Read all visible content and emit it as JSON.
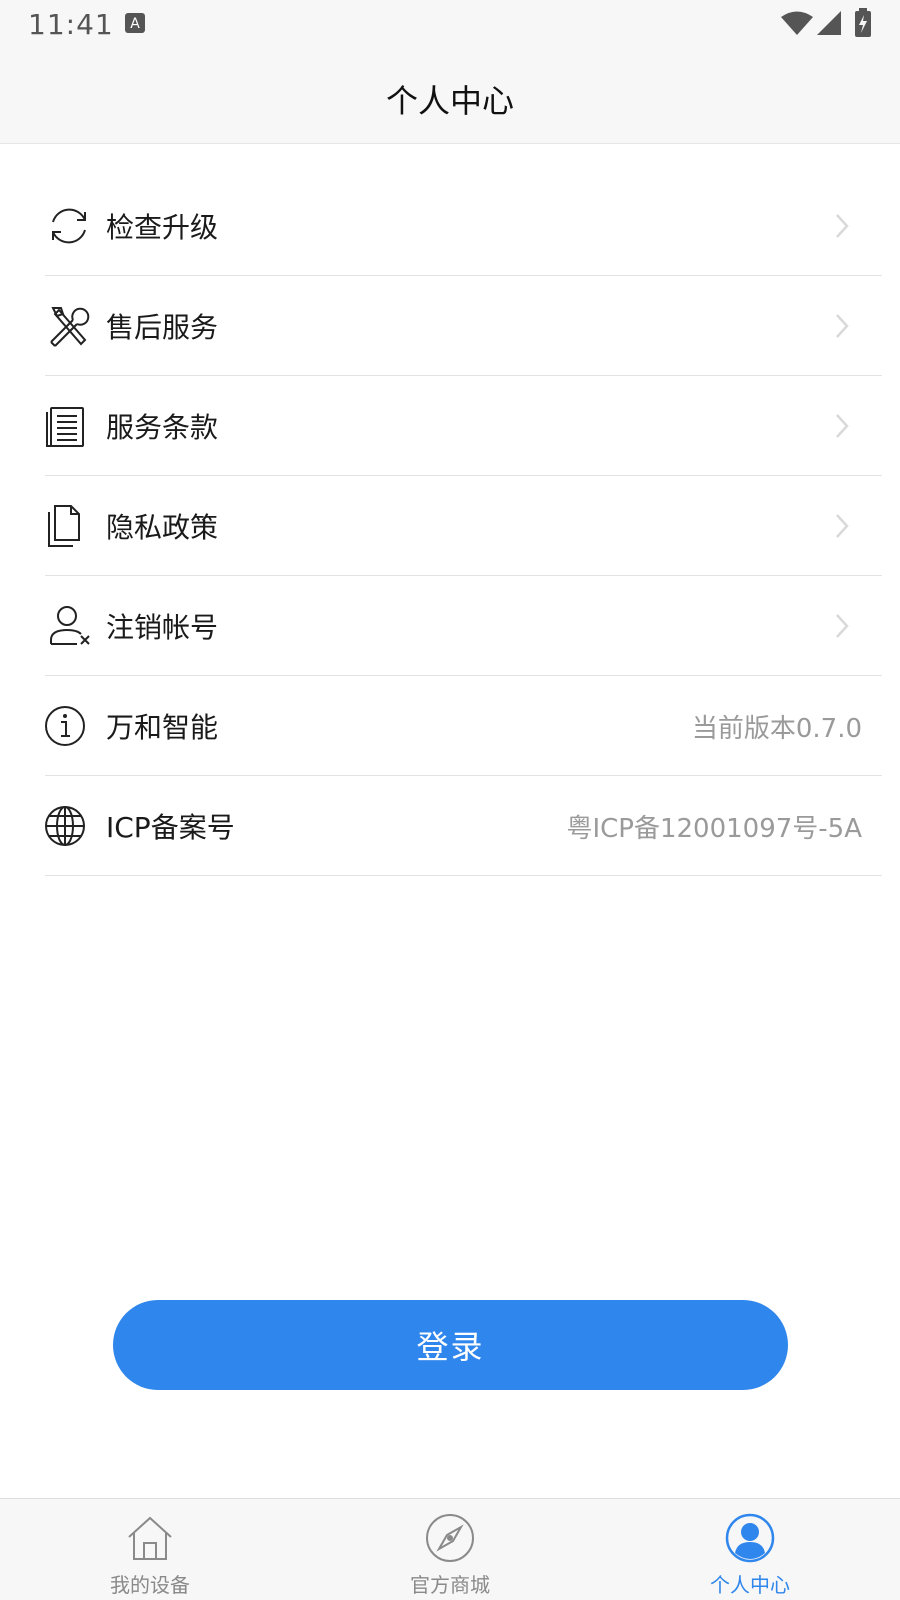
{
  "status_bar": {
    "time": "11:41",
    "icons": [
      "a-notification-icon",
      "wifi-icon",
      "signal-icon",
      "battery-charging-icon"
    ]
  },
  "header": {
    "title": "个人中心"
  },
  "menu": {
    "items": [
      {
        "label": "检查升级",
        "icon": "refresh-icon",
        "value": "",
        "chevron": true
      },
      {
        "label": "售后服务",
        "icon": "tools-icon",
        "value": "",
        "chevron": true
      },
      {
        "label": "服务条款",
        "icon": "document-list-icon",
        "value": "",
        "chevron": true
      },
      {
        "label": "隐私政策",
        "icon": "files-icon",
        "value": "",
        "chevron": true
      },
      {
        "label": "注销帐号",
        "icon": "user-remove-icon",
        "value": "",
        "chevron": true
      },
      {
        "label": "万和智能",
        "icon": "info-icon",
        "value": "当前版本0.7.0",
        "chevron": false
      },
      {
        "label": "ICP备案号",
        "icon": "globe-icon",
        "value": "粤ICP备12001097号-5A",
        "chevron": false
      }
    ]
  },
  "login": {
    "label": "登录"
  },
  "tabs": [
    {
      "label": "我的设备",
      "icon": "home-icon",
      "active": false
    },
    {
      "label": "官方商城",
      "icon": "compass-icon",
      "active": false
    },
    {
      "label": "个人中心",
      "icon": "user-icon",
      "active": true
    }
  ],
  "colors": {
    "accent": "#2f86ec",
    "muted_text": "#9a9a9a",
    "divider": "#e3e3e3"
  }
}
